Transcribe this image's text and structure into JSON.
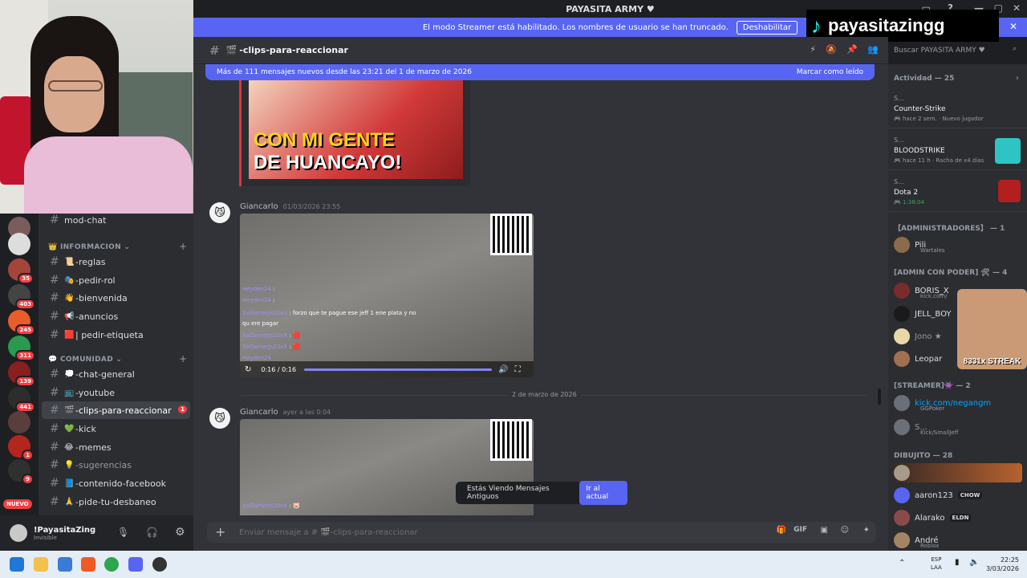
{
  "window": {
    "title": "PAYASITA ARMY ♥"
  },
  "banner": {
    "text": "El modo Streamer está habilitado. Los nombres de usuario se han truncado.",
    "button": "Deshabilitar"
  },
  "overlay": {
    "tiktok_handle": "payasitazingg",
    "streak_text": "8331x STREAK"
  },
  "channel": {
    "name": "-clips-para-reaccionar",
    "search_placeholder": "Buscar PAYASITA ARMY ♥"
  },
  "new_messages": {
    "text": "Más de 111 mensajes nuevos desde las 23:21 del 1 de marzo de 2026",
    "mark_read": "Marcar como leído"
  },
  "thumbnail": {
    "caption_line1": "CON MI GENTE",
    "caption_line2": "DE HUANCAYO!"
  },
  "messages": [
    {
      "author": "Giancarlo",
      "time": "01/03/2026 23:55",
      "video_time": "0:16 / 0:16",
      "chat": [
        {
          "user": "Heyden24",
          "text": ""
        },
        {
          "user": "Heyden24",
          "text": ""
        },
        {
          "user": "XxGamerJs20xX",
          "text": "forzo que te pague ese jeff 1 ene plata y no"
        },
        {
          "user": "",
          "text": "qu ere pagar"
        },
        {
          "user": "XxGamerJs20xX",
          "text": ""
        },
        {
          "user": "XxGamerJs20xX",
          "text": ""
        },
        {
          "user": "Heyden24",
          "text": ""
        }
      ]
    },
    {
      "author": "Giancarlo",
      "time": "ayer a las 0:04",
      "chat": [
        {
          "user": "XxGamerJs20xX",
          "text": ""
        }
      ]
    }
  ],
  "date_divider": "2 de marzo de 2026",
  "old_messages": {
    "text": "Estás Viendo Mensajes Antiguos",
    "button": "Ir al actual"
  },
  "composer": {
    "placeholder": "Enviar mensaje a # 🎬-clips-para-reaccionar"
  },
  "sidebar": {
    "top_channel": "mod-chat",
    "categories": [
      {
        "label": "INFORMACION"
      },
      {
        "label": "COMUNIDAD"
      }
    ],
    "info_channels": [
      {
        "emoji": "📜",
        "label": "-reglas"
      },
      {
        "emoji": "🎭",
        "label": "-pedir-rol"
      },
      {
        "emoji": "👋",
        "label": "-bienvenida"
      },
      {
        "emoji": "📢",
        "label": "-anuncios"
      },
      {
        "emoji": "🟥",
        "label": "| pedir-etiqueta"
      }
    ],
    "community_channels": [
      {
        "emoji": "💭",
        "label": "-chat-general"
      },
      {
        "emoji": "📺",
        "label": "-youtube"
      },
      {
        "emoji": "🎬",
        "label": "-clips-para-reaccionar",
        "badge": "1"
      },
      {
        "emoji": "💚",
        "label": "-kick"
      },
      {
        "emoji": "😂",
        "label": "-memes"
      },
      {
        "emoji": "💡",
        "label": "-sugerencias"
      },
      {
        "emoji": "📘",
        "label": "-contenido-facebook"
      },
      {
        "emoji": "🙏",
        "label": "-pide-tu-desbaneo"
      }
    ],
    "server_badges": [
      "1",
      "35",
      "403",
      "245",
      "311",
      "139",
      "441",
      "1",
      "9"
    ],
    "new_label": "NUEVO"
  },
  "user": {
    "name": "!PayasitaZing",
    "status": "Invisible"
  },
  "members": {
    "activity_header": "Actividad — 25",
    "activities": [
      {
        "name": "Counter-Strike",
        "sub": "hace 2 sem.",
        "extra": "Nuevo jugador",
        "user": "S..."
      },
      {
        "name": "BLOODSTRIKE",
        "sub": "hace 11 h",
        "extra": "Racha de x4 días",
        "user": "S..."
      },
      {
        "name": "Dota 2",
        "sub": "1:38:04",
        "extra": "",
        "user": "S..."
      }
    ],
    "groups": [
      {
        "label": "【ADMINISTRADORES】 — 1",
        "members": [
          {
            "name": "Pili",
            "sub": "Wartales"
          }
        ]
      },
      {
        "label": "[ADMIN CON PODER] 🛠 — 4",
        "members": [
          {
            "name": "BORIS_X",
            "sub": "kick.com/"
          },
          {
            "name": "JELL_BOY",
            "sub": ""
          },
          {
            "name": "Jono ★",
            "sub": ""
          },
          {
            "name": "Leopar",
            "sub": ""
          }
        ]
      },
      {
        "label": "[STREAMER]👾 — 2",
        "members": [
          {
            "name": "kick.com/negangm",
            "sub": "GGPoker"
          },
          {
            "name": "S...",
            "sub": "Kick/SmallJeff"
          }
        ]
      },
      {
        "label": "DIBUJITO — 28",
        "members": [
          {
            "name": "",
            "sub": ""
          },
          {
            "name": "aaron123",
            "tag": "CHOW",
            "sub": ""
          },
          {
            "name": "Alarako",
            "tag": "ELDN",
            "sub": ""
          },
          {
            "name": "André",
            "sub": "Roblox"
          }
        ]
      }
    ]
  },
  "taskbar": {
    "lang1": "ESP",
    "lang2": "LAA",
    "time": "22:25",
    "date": "3/03/2026"
  }
}
